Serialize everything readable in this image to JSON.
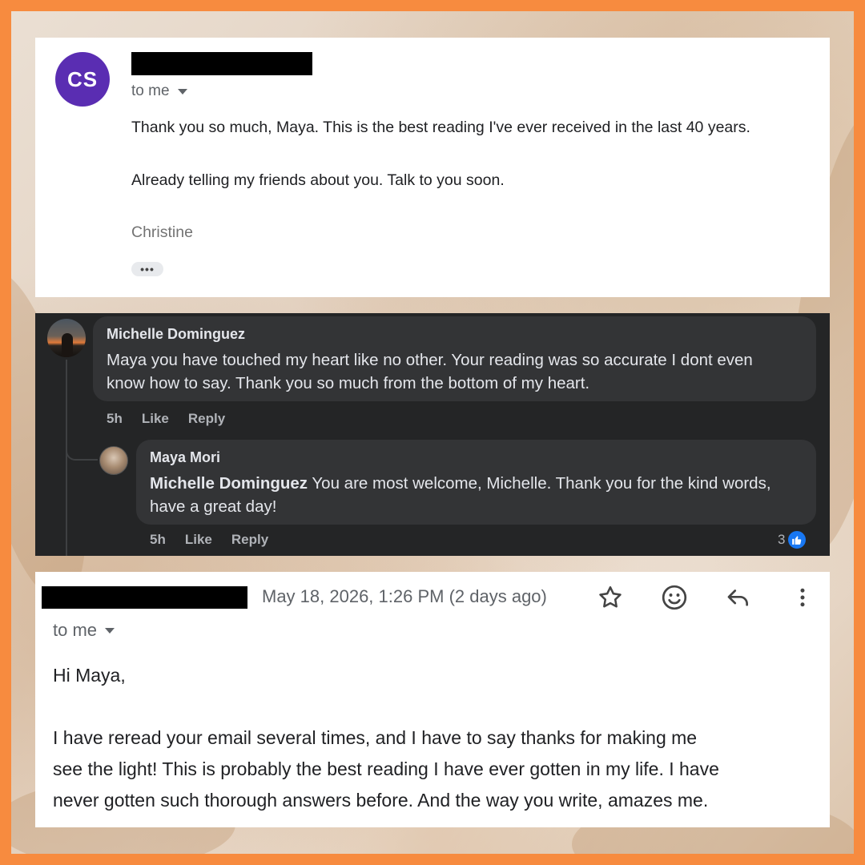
{
  "colors": {
    "frame": "#f78b3f",
    "gmail_avatar": "#5a2db2",
    "comment_card": "#242526",
    "comment_bubble": "#333436",
    "like_blue": "#1877f2"
  },
  "email_1": {
    "avatar_initials": "CS",
    "recipient": "to me",
    "body_line_1": "Thank you so much, Maya. This is the best reading I've ever received in the last 40 years.",
    "body_line_2": "Already telling my friends about you. Talk to you soon.",
    "signature": "Christine",
    "show_trimmed_label": "•••"
  },
  "comments": {
    "michelle": {
      "author": "Michelle Dominguez",
      "text": "Maya you have touched my heart like no other. Your reading was so accurate I dont even know how to say. Thank you so much from the bottom of my heart.",
      "time": "5h",
      "like_label": "Like",
      "reply_label": "Reply"
    },
    "maya": {
      "author": "Maya Mori",
      "mention": "Michelle Dominguez",
      "text": " You are most welcome, Michelle. Thank you for the kind words, have a great day!",
      "time": "5h",
      "like_label": "Like",
      "reply_label": "Reply",
      "reaction_count": "3",
      "reaction_icon": "thumbs-up-icon"
    }
  },
  "email_2": {
    "date": "May 18, 2026, 1:26 PM (2 days ago)",
    "recipient": "to me",
    "greeting": "Hi Maya,",
    "body_line_1": "I have reread your email several times, and I have to say thanks for making me",
    "body_line_2": "see the light! This is probably the best reading I have ever gotten in my life. I have",
    "body_line_3": "never gotten such thorough answers before. And the way you write, amazes me.",
    "toolbar_icons": [
      "star-icon",
      "emoji-icon",
      "reply-icon",
      "more-vert-icon"
    ]
  }
}
